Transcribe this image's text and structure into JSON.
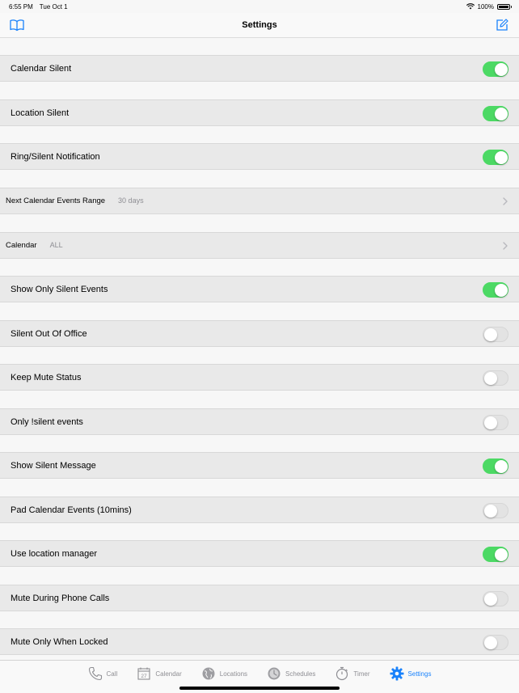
{
  "status": {
    "time": "6:55 PM",
    "date": "Tue Oct 1",
    "battery": "100%"
  },
  "nav": {
    "title": "Settings",
    "left_icon": "book-icon",
    "right_icon": "compose-icon"
  },
  "accent": "#1a82fb",
  "toggle_on_color": "#4cd964",
  "rows": [
    {
      "label": "Calendar Silent",
      "type": "toggle",
      "on": true
    },
    {
      "label": "Location Silent",
      "type": "toggle",
      "on": true
    },
    {
      "label": "Ring/Silent Notification",
      "type": "toggle",
      "on": true
    },
    {
      "label": "Next Calendar Events Range",
      "type": "nav",
      "value": "30 days"
    },
    {
      "label": "Calendar",
      "type": "nav",
      "value": "ALL"
    },
    {
      "label": "Show Only Silent Events",
      "type": "toggle",
      "on": true
    },
    {
      "label": "Silent Out Of Office",
      "type": "toggle",
      "on": false
    },
    {
      "label": "Keep Mute Status",
      "type": "toggle",
      "on": false
    },
    {
      "label": "Only !silent events",
      "type": "toggle",
      "on": false
    },
    {
      "label": "Show Silent Message",
      "type": "toggle",
      "on": true
    },
    {
      "label": "Pad Calendar Events (10mins)",
      "type": "toggle",
      "on": false
    },
    {
      "label": "Use location manager",
      "type": "toggle",
      "on": true
    },
    {
      "label": "Mute During Phone Calls",
      "type": "toggle",
      "on": false
    },
    {
      "label": "Mute Only When Locked",
      "type": "toggle",
      "on": false
    }
  ],
  "tabs": [
    {
      "label": "Call",
      "icon": "phone-icon",
      "active": false
    },
    {
      "label": "Calendar",
      "icon": "calendar-icon",
      "calendar_day": "27",
      "active": false
    },
    {
      "label": "Locations",
      "icon": "globe-icon",
      "active": false
    },
    {
      "label": "Schedules",
      "icon": "clock-icon",
      "active": false
    },
    {
      "label": "Timer",
      "icon": "stopwatch-icon",
      "active": false
    },
    {
      "label": "Settings",
      "icon": "gear-icon",
      "active": true
    }
  ]
}
